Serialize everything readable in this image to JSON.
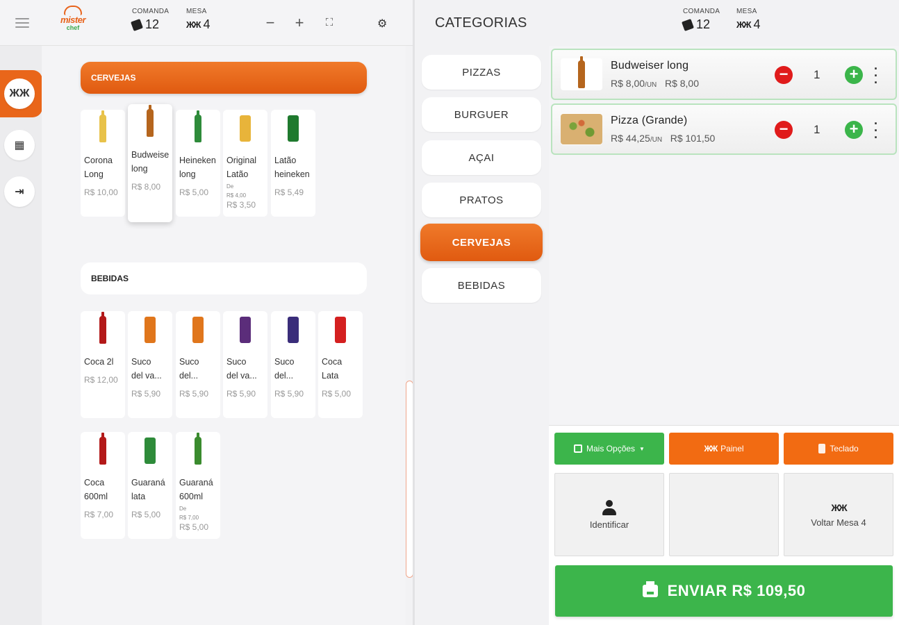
{
  "header": {
    "comanda_label": "COMANDA",
    "comanda_value": "12",
    "mesa_label": "MESA",
    "mesa_value": "4",
    "minus": "−",
    "plus": "+",
    "fit": "⛶",
    "gear": "⚙"
  },
  "logo": {
    "line1": "mister",
    "line2": "chef"
  },
  "rail": {
    "table_icon": "ꟷꟷ",
    "calc_icon": "▦",
    "exit_icon": "⇥"
  },
  "products": {
    "cervejas": {
      "title": "CERVEJAS",
      "items": [
        {
          "name1": "Corona",
          "name2": "Long",
          "price": "R$ 10,00",
          "color": "#e8c24a"
        },
        {
          "name1": "Budweiser",
          "name2": "long",
          "price": "R$ 8,00",
          "color": "#b5651d"
        },
        {
          "name1": "Heineken",
          "name2": "long",
          "price": "R$ 5,00",
          "color": "#2e8b3a"
        },
        {
          "name1": "Original",
          "name2": "Latão",
          "old_label": "De",
          "old_price": "R$ 4,00",
          "price": "R$ 3,50",
          "color": "#e8b43a"
        },
        {
          "name1": "Latão",
          "name2": "heineken",
          "price": "R$ 5,49",
          "color": "#1f7a2e"
        }
      ]
    },
    "bebidas": {
      "title": "BEBIDAS",
      "items": [
        {
          "name1": "Coca 2l",
          "name2": "",
          "price": "R$ 12,00",
          "color": "#b31919"
        },
        {
          "name1": "Suco",
          "name2": "del va...",
          "price": "R$ 5,90",
          "color": "#e0761c"
        },
        {
          "name1": "Suco",
          "name2": "del...",
          "price": "R$ 5,90",
          "color": "#e0761c"
        },
        {
          "name1": "Suco",
          "name2": "del va...",
          "price": "R$ 5,90",
          "color": "#5b2d7a"
        },
        {
          "name1": "Suco",
          "name2": "del...",
          "price": "R$ 5,90",
          "color": "#3a2d7a"
        },
        {
          "name1": "Coca",
          "name2": "Lata",
          "price": "R$ 5,00",
          "color": "#d42020"
        },
        {
          "name1": "Coca",
          "name2": "600ml",
          "price": "R$ 7,00",
          "color": "#b31919"
        },
        {
          "name1": "Guaraná",
          "name2": "lata",
          "price": "R$ 5,00",
          "color": "#2e8b3a"
        },
        {
          "name1": "Guaraná",
          "name2": "600ml",
          "old_label": "De",
          "old_price": "R$ 7,00",
          "price": "R$ 5,00",
          "color": "#3a8b2e"
        }
      ]
    }
  },
  "categories": {
    "title": "CATEGORIAS",
    "items": [
      "PIZZAS",
      "BURGUER",
      "AÇAI",
      "PRATOS",
      "CERVEJAS",
      "BEBIDAS"
    ],
    "active": "CERVEJAS"
  },
  "order": {
    "items": [
      {
        "name": "Budweiser long",
        "unit_price": "R$ 8,00",
        "unit_suffix": "/UN",
        "total": "R$ 8,00",
        "qty": "1"
      },
      {
        "name": "Pizza (Grande)",
        "unit_price": "R$ 44,25",
        "unit_suffix": "/UN",
        "total": "R$ 101,50",
        "qty": "1"
      }
    ]
  },
  "actions": {
    "mais_opcoes": "Mais Opções",
    "painel": "Painel",
    "teclado": "Teclado",
    "identificar": "Identificar",
    "voltar_mesa": "Voltar Mesa 4",
    "send": "ENVIAR  R$ 109,50"
  },
  "colors": {
    "accent": "#e9661a",
    "green": "#3cb54b",
    "red": "#e01b1b"
  }
}
